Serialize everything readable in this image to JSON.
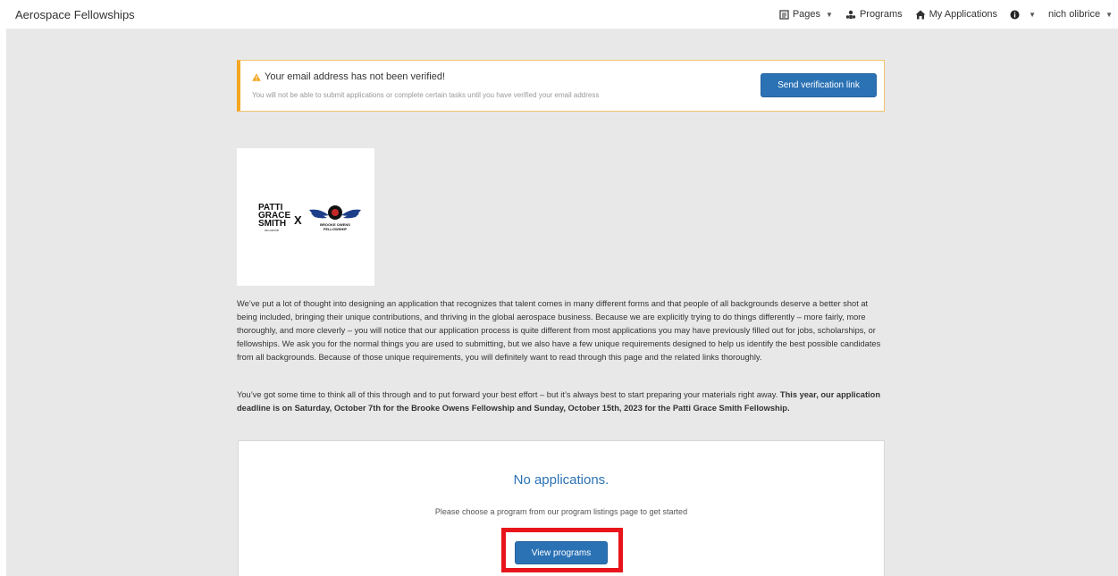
{
  "navbar": {
    "brand": "Aerospace Fellowships",
    "items": [
      {
        "icon": "document-icon",
        "label": "Pages",
        "has_caret": true
      },
      {
        "icon": "programs-icon",
        "label": "Programs",
        "has_caret": false
      },
      {
        "icon": "home-icon",
        "label": "My Applications",
        "has_caret": false
      },
      {
        "icon": "info-icon",
        "label": "",
        "has_caret": true
      },
      {
        "icon": "",
        "label": "nich olibrice",
        "has_caret": true
      }
    ]
  },
  "alert": {
    "icon": "warning-icon",
    "title": "Your email address has not been verified!",
    "message": "You will not be able to submit applications or complete certain tasks until you have verified your email address",
    "button_label": "Send verification link",
    "accent_color": "#f5a623"
  },
  "logo": {
    "left_text": [
      "PATTI",
      "GRACE",
      "SMITH"
    ],
    "left_small": "FELLOWSHIP",
    "separator": "X",
    "right_text": [
      "BROOKE OWENS",
      "FELLOWSHIP"
    ]
  },
  "intro": {
    "paragraph1": "We’ve put a lot of thought into designing an application that recognizes that talent comes in many different forms and that people of all backgrounds deserve a better shot at being included, bringing their unique contributions, and thriving in the global aerospace business. Because we are explicitly trying to do things differently – more fairly, more thoroughly, and more cleverly – you will notice that our application process is quite different from most applications you may have previously filled out for jobs, scholarships, or fellowships. We ask you for the normal things you are used to submitting, but we also have a few unique requirements designed to help us identify the best possible candidates from all backgrounds. Because of those unique requirements, you will definitely want to read through this page and the related links thoroughly.",
    "paragraph2_plain": "You’ve got some time to think all of this through and to put forward your best effort – but it’s always best to start preparing your materials right away. ",
    "paragraph2_bold": "This year, our application deadline is on Saturday, October 7th for the Brooke Owens Fellowship and Sunday, October 15th, 2023 for the Patti Grace Smith Fellowship."
  },
  "applications_card": {
    "title": "No applications.",
    "message": "Please choose a program from our program listings page to get started",
    "button_label": "View programs",
    "highlight_color": "#e8141b"
  },
  "colors": {
    "primary": "#2b72b5",
    "background": "#e8e8e8"
  }
}
